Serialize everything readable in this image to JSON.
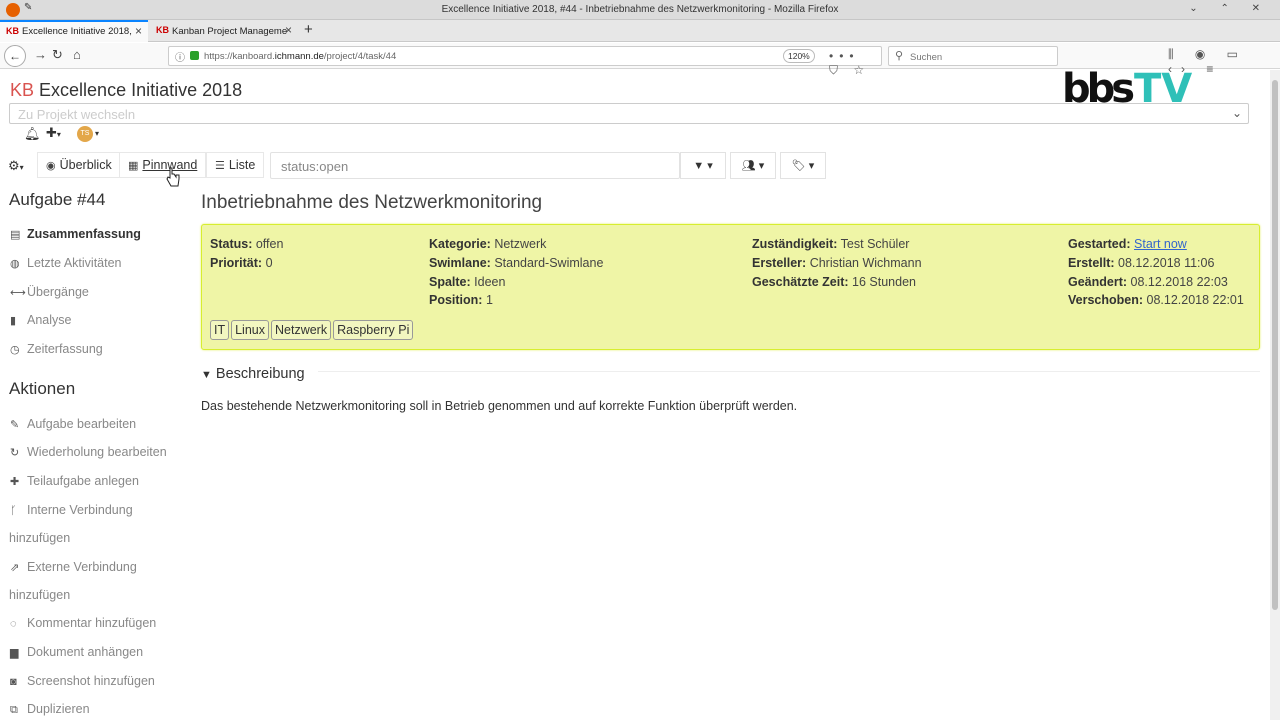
{
  "window": {
    "title": "Excellence Initiative 2018, #44 - Inbetriebnahme des Netzwerkmonitoring - Mozilla Firefox",
    "controls": "⌄ ⌃ ✕"
  },
  "tabs": [
    {
      "icon": "KB",
      "label": "Excellence Initiative 2018,",
      "close": "×"
    },
    {
      "icon": "KB",
      "label": "Kanban Project Manageme",
      "close": "×"
    }
  ],
  "newtab": "+",
  "nav": {
    "url_prefix": "https://kanboard.",
    "url_domain": "ichmann.de",
    "url_path": "/project/4/task/44",
    "zoom": "120%",
    "url_actions": "••• ⛉ ☆",
    "search_placeholder": "Suchen",
    "right_icons": "⫼ ◉ ▭ ‹› ≡"
  },
  "app": {
    "kb": "KB",
    "title": "Excellence Initiative 2018",
    "project_switch_placeholder": "Zu Projekt wechseln",
    "avatar_initials": "TS",
    "logo_text": "bbsTV"
  },
  "toolbar": {
    "overview": "Überblick",
    "board": "Pinnwand",
    "list": "Liste",
    "filter_value": "status:open"
  },
  "sidebar": {
    "task_title": "Aufgabe #44",
    "items": [
      {
        "label": "Zusammenfassung",
        "icon": "▤"
      },
      {
        "label": "Letzte Aktivitäten",
        "icon": "◍"
      },
      {
        "label": "Übergänge",
        "icon": "⟷"
      },
      {
        "label": "Analyse",
        "icon": "▮"
      },
      {
        "label": "Zeiterfassung",
        "icon": "◷"
      }
    ],
    "actions_title": "Aktionen",
    "actions": [
      {
        "label": "Aufgabe bearbeiten",
        "icon": "✎"
      },
      {
        "label": "Wiederholung bearbeiten",
        "icon": "↻"
      },
      {
        "label": "Teilaufgabe anlegen",
        "icon": "✚"
      },
      {
        "label": "Interne Verbindung",
        "cont": "hinzufügen",
        "icon": "ᚴ"
      },
      {
        "label": "Externe Verbindung",
        "cont": "hinzufügen",
        "icon": "⇗"
      },
      {
        "label": "Kommentar hinzufügen",
        "icon": "◌"
      },
      {
        "label": "Dokument anhängen",
        "icon": "▆"
      },
      {
        "label": "Screenshot hinzufügen",
        "icon": "◙"
      },
      {
        "label": "Duplizieren",
        "icon": "⧉"
      }
    ]
  },
  "task": {
    "title": "Inbetriebnahme des Netzwerkmonitoring",
    "col1": [
      {
        "k": "Status:",
        "v": "offen"
      },
      {
        "k": "Priorität:",
        "v": "0"
      }
    ],
    "col2": [
      {
        "k": "Kategorie:",
        "v": "Netzwerk"
      },
      {
        "k": "Swimlane:",
        "v": "Standard-Swimlane"
      },
      {
        "k": "Spalte:",
        "v": "Ideen"
      },
      {
        "k": "Position:",
        "v": "1"
      }
    ],
    "col3": [
      {
        "k": "Zuständigkeit:",
        "v": "Test Schüler"
      },
      {
        "k": "Ersteller:",
        "v": "Christian Wichmann"
      },
      {
        "k": "Geschätzte Zeit:",
        "v": "16 Stunden"
      }
    ],
    "col4": [
      {
        "k": "Gestarted:",
        "v": "Start now"
      },
      {
        "k": "Erstellt:",
        "v": "08.12.2018 11:06"
      },
      {
        "k": "Geändert:",
        "v": "08.12.2018 22:03"
      },
      {
        "k": "Verschoben:",
        "v": "08.12.2018 22:01"
      }
    ],
    "tags": [
      "IT",
      "Linux",
      "Netzwerk",
      "Raspberry Pi"
    ],
    "description_heading": "Beschreibung",
    "description": "Das bestehende Netzwerkmonitoring soll in Betrieb genommen und auf korrekte Funktion überprüft werden."
  }
}
